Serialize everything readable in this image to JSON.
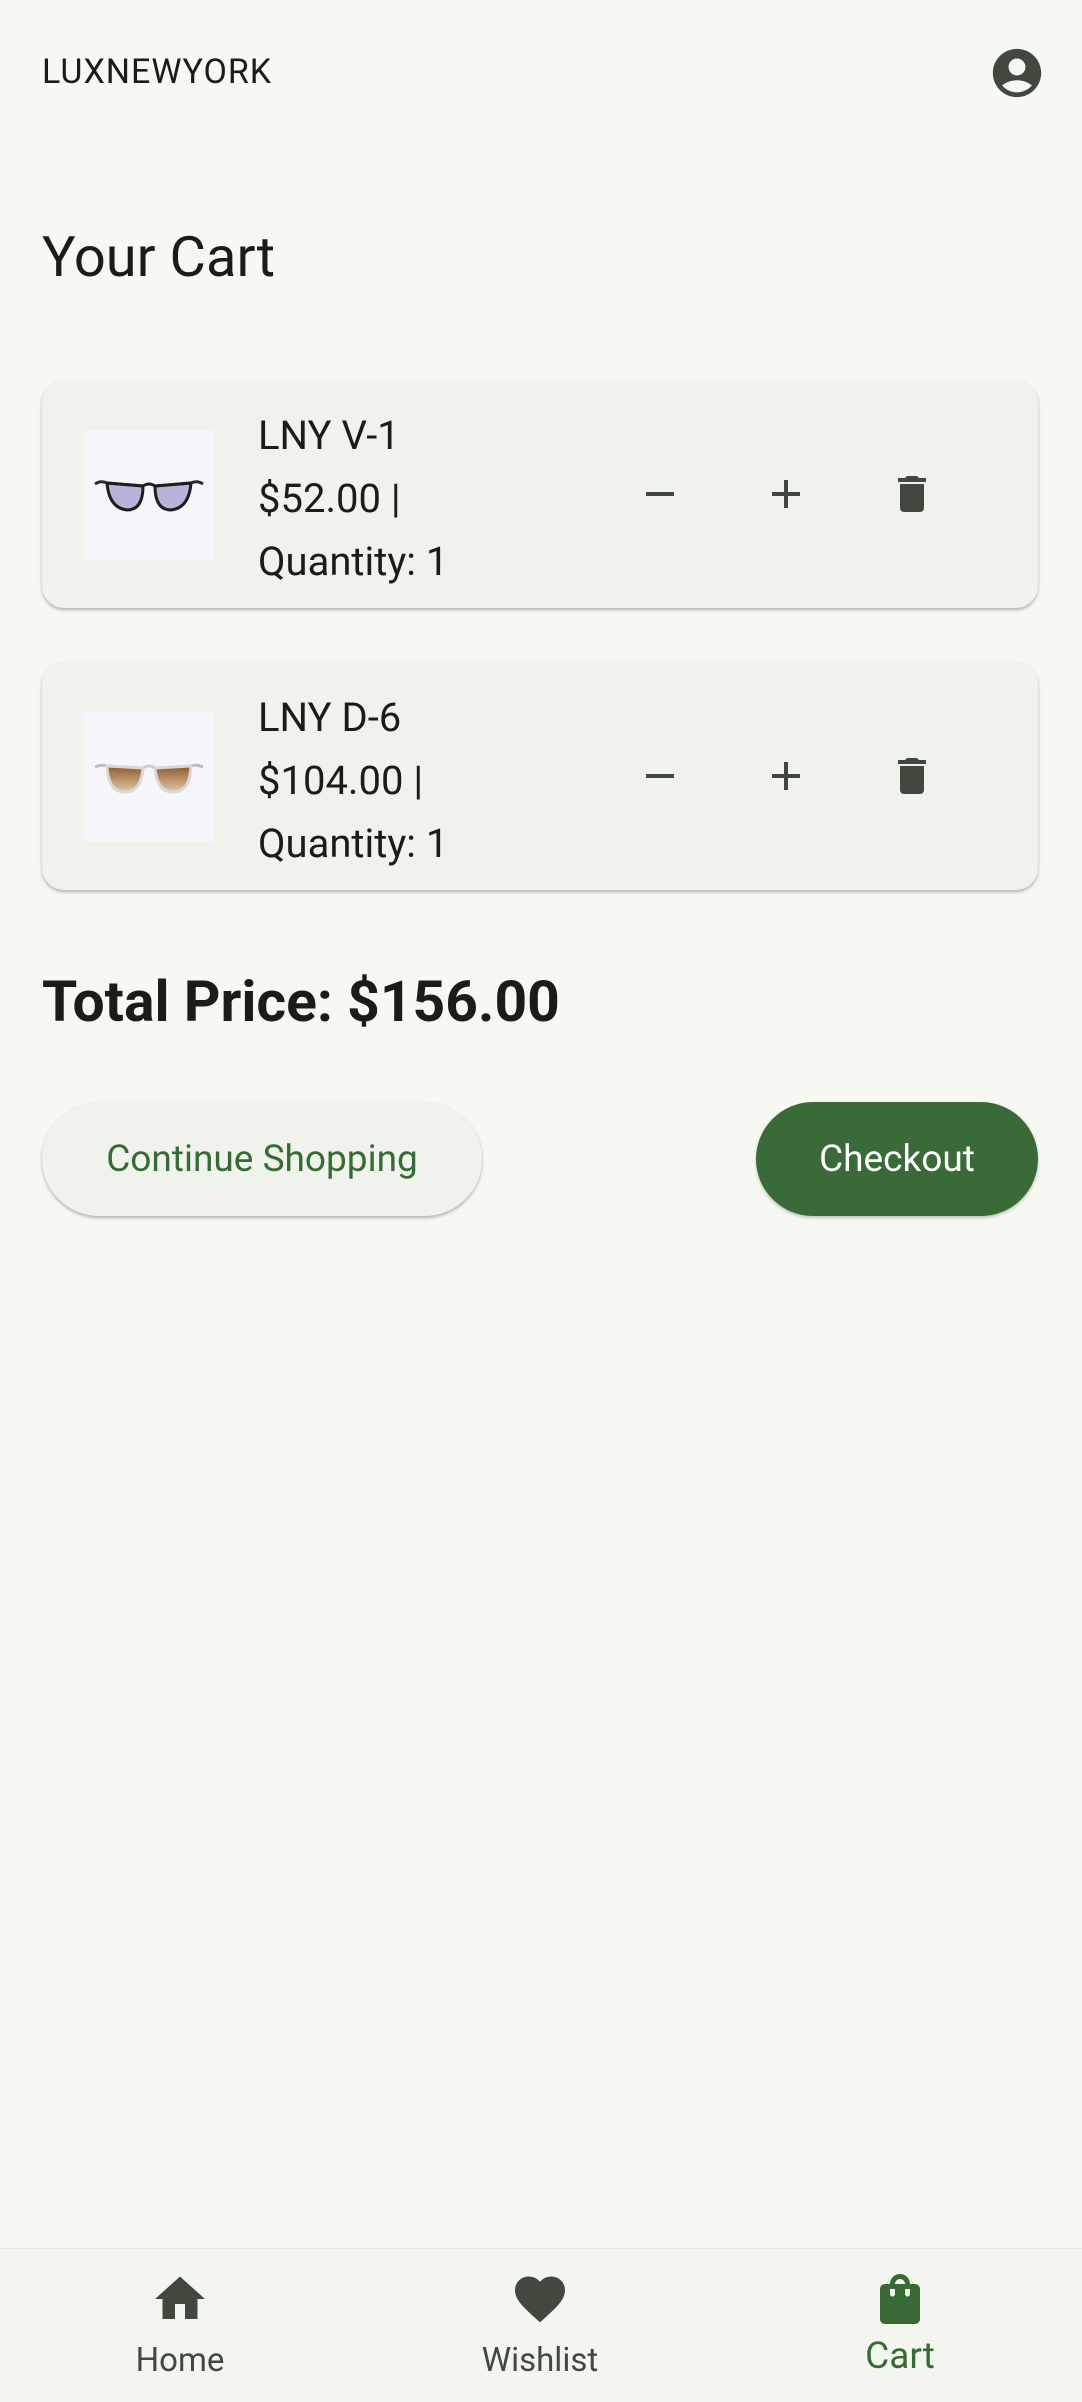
{
  "app": {
    "brand": "LUXNEWYORK"
  },
  "page": {
    "title": "Your Cart"
  },
  "cart": {
    "items": [
      {
        "name": "LNY V-1",
        "price_line": "$52.00 |",
        "quantity_line": "Quantity: 1",
        "image_icon": "sunglasses-round-purple-tint"
      },
      {
        "name": "LNY D-6",
        "price_line": "$104.00 |",
        "quantity_line": "Quantity: 1",
        "image_icon": "sunglasses-clear-frame-brown-tint"
      }
    ],
    "total_line": "Total Price: $156.00"
  },
  "actions": {
    "continue_label": "Continue Shopping",
    "checkout_label": "Checkout"
  },
  "bottom_nav": {
    "items": [
      {
        "label": "Home",
        "icon": "home-icon",
        "active": false
      },
      {
        "label": "Wishlist",
        "icon": "heart-icon",
        "active": false
      },
      {
        "label": "Cart",
        "icon": "shopping-bag-icon",
        "active": true
      }
    ]
  },
  "colors": {
    "background": "#f6f9f1",
    "card": "#f0f3eb",
    "primary": "#3a6a38",
    "primary_text": "#386a35",
    "icon": "#43483f",
    "text": "#1b1c18"
  }
}
